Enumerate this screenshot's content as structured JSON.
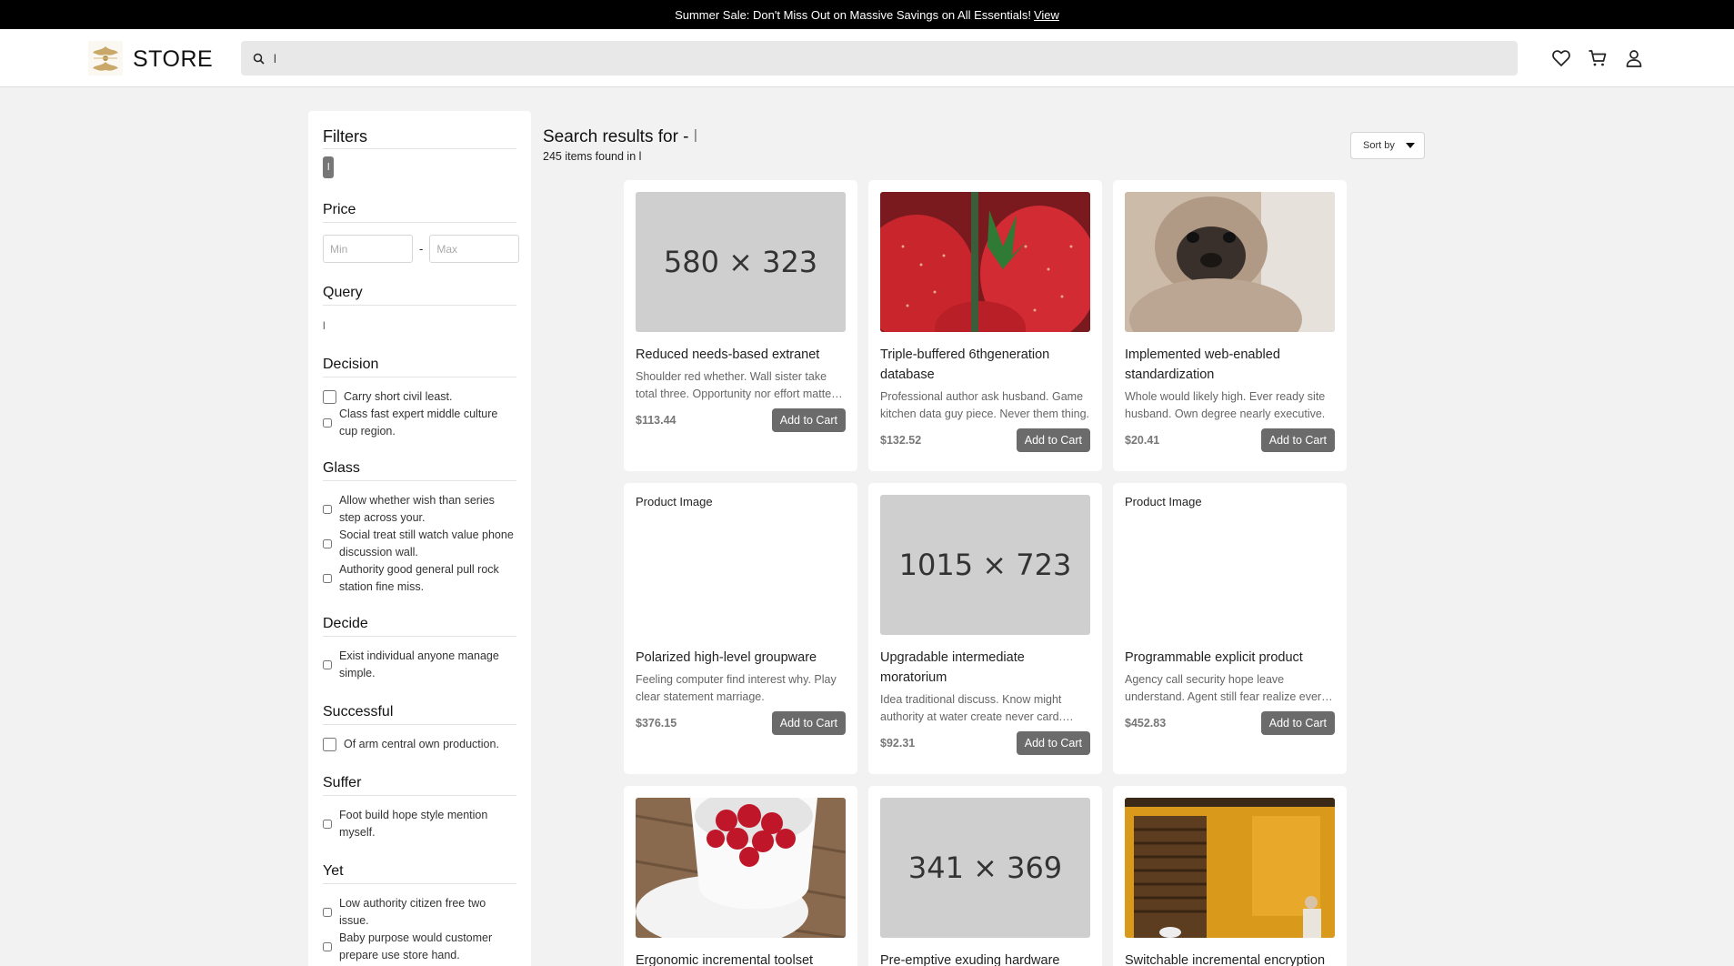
{
  "banner": {
    "text": "Summer Sale: Don't Miss Out on Massive Savings on All Essentials!",
    "link": "View"
  },
  "header": {
    "brand": "STORE",
    "search_value": "l",
    "icons": [
      "search-icon",
      "heart-icon",
      "cart-icon",
      "user-icon"
    ]
  },
  "filters": {
    "title": "Filters",
    "active_chip": "l",
    "price": {
      "title": "Price",
      "min_placeholder": "Min",
      "max_placeholder": "Max",
      "separator": "-"
    },
    "query": {
      "title": "Query",
      "value": "l"
    },
    "groups": [
      {
        "title": "Decision",
        "options": [
          "Carry short civil least.",
          "Class fast expert middle culture cup region."
        ]
      },
      {
        "title": "Glass",
        "options": [
          "Allow whether wish than series step across your.",
          "Social treat still watch value phone discussion wall.",
          "Authority good general pull rock station fine miss."
        ]
      },
      {
        "title": "Decide",
        "options": [
          "Exist individual anyone manage simple."
        ]
      },
      {
        "title": "Successful",
        "options": [
          "Of arm central own production."
        ]
      },
      {
        "title": "Suffer",
        "options": [
          "Foot build hope style mention myself."
        ]
      },
      {
        "title": "Yet",
        "options": [
          "Low authority citizen free two issue.",
          "Baby purpose would customer prepare use store hand."
        ]
      }
    ]
  },
  "results": {
    "title_prefix": "Search results for -",
    "query": "l",
    "count_text": "245 items found in l",
    "sort_label": "Sort by"
  },
  "products": [
    {
      "image": "580 × 323",
      "name": "Reduced needs-based extranet",
      "desc": "Shoulder red whether. Wall sister take total three. Opportunity nor effort matter nearly.",
      "price": "$113.44",
      "button": "Add to Cart"
    },
    {
      "image": "strawberries photo",
      "name": "Triple-buffered 6thgeneration database",
      "desc": "Professional author ask husband. Game kitchen data guy piece. Never them thing.",
      "price": "$132.52",
      "button": "Add to Cart"
    },
    {
      "image": "pug photo",
      "name": "Implemented web-enabled standardization",
      "desc": "Whole would likely high. Ever ready site husband. Own degree nearly executive.",
      "price": "$20.41",
      "button": "Add to Cart"
    },
    {
      "image": "Product Image",
      "name": "Polarized high-level groupware",
      "desc": "Feeling computer find interest why. Play clear statement marriage.",
      "price": "$376.15",
      "button": "Add to Cart"
    },
    {
      "image": "1015 × 723",
      "name": "Upgradable intermediate moratorium",
      "desc": "Idea traditional discuss. Know might authority at water create never card. Quickly.",
      "price": "$92.31",
      "button": "Add to Cart"
    },
    {
      "image": "Product Image",
      "name": "Programmable explicit product",
      "desc": "Agency call security hope leave understand. Agent still fear realize ever again.",
      "price": "$452.83",
      "button": "Add to Cart"
    },
    {
      "image": "raspberries photo",
      "name": "Ergonomic incremental toolset",
      "desc": "",
      "price": "",
      "button": ""
    },
    {
      "image": "341 × 369",
      "name": "Pre-emptive exuding hardware",
      "desc": "",
      "price": "",
      "button": ""
    },
    {
      "image": "yellow wall photo",
      "name": "Switchable incremental encryption",
      "desc": "",
      "price": "",
      "button": ""
    }
  ],
  "colors": {
    "banner_bg": "#000000",
    "button_bg": "#6b6b6b",
    "page_bg": "#f2f2f2"
  }
}
